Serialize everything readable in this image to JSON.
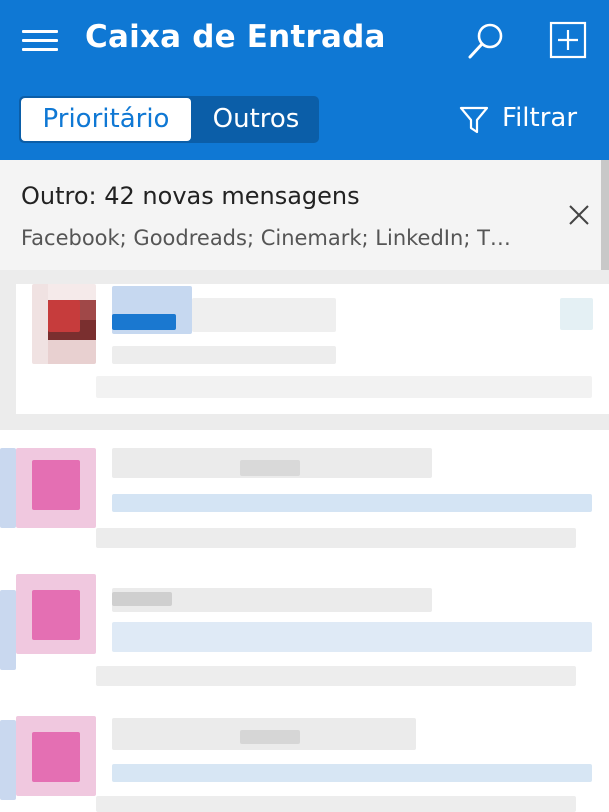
{
  "header": {
    "title": "Caixa de Entrada",
    "menu_icon": "hamburger-menu-icon",
    "search_icon": "search-icon",
    "compose_icon": "compose-new-icon",
    "background_color": "#0f78d4"
  },
  "tabs": {
    "focused_label": "Prioritário",
    "other_label": "Outros",
    "active": "focused"
  },
  "filter": {
    "label": "Filtrar",
    "icon": "filter-icon"
  },
  "other_banner": {
    "title": "Outro: 42 novas mensagens",
    "senders": "Facebook; Goodreads; Cinemark; LinkedIn; T…",
    "close_icon": "close-icon"
  },
  "messages": [
    {
      "state": "selected",
      "avatar_color": "#8b3a3a",
      "content": "blurred"
    },
    {
      "state": "normal",
      "avatar_color": "#e87ab8",
      "content": "blurred"
    },
    {
      "state": "normal",
      "avatar_color": "#e87ab8",
      "content": "blurred"
    },
    {
      "state": "normal",
      "avatar_color": "#e87ab8",
      "content": "blurred"
    }
  ]
}
